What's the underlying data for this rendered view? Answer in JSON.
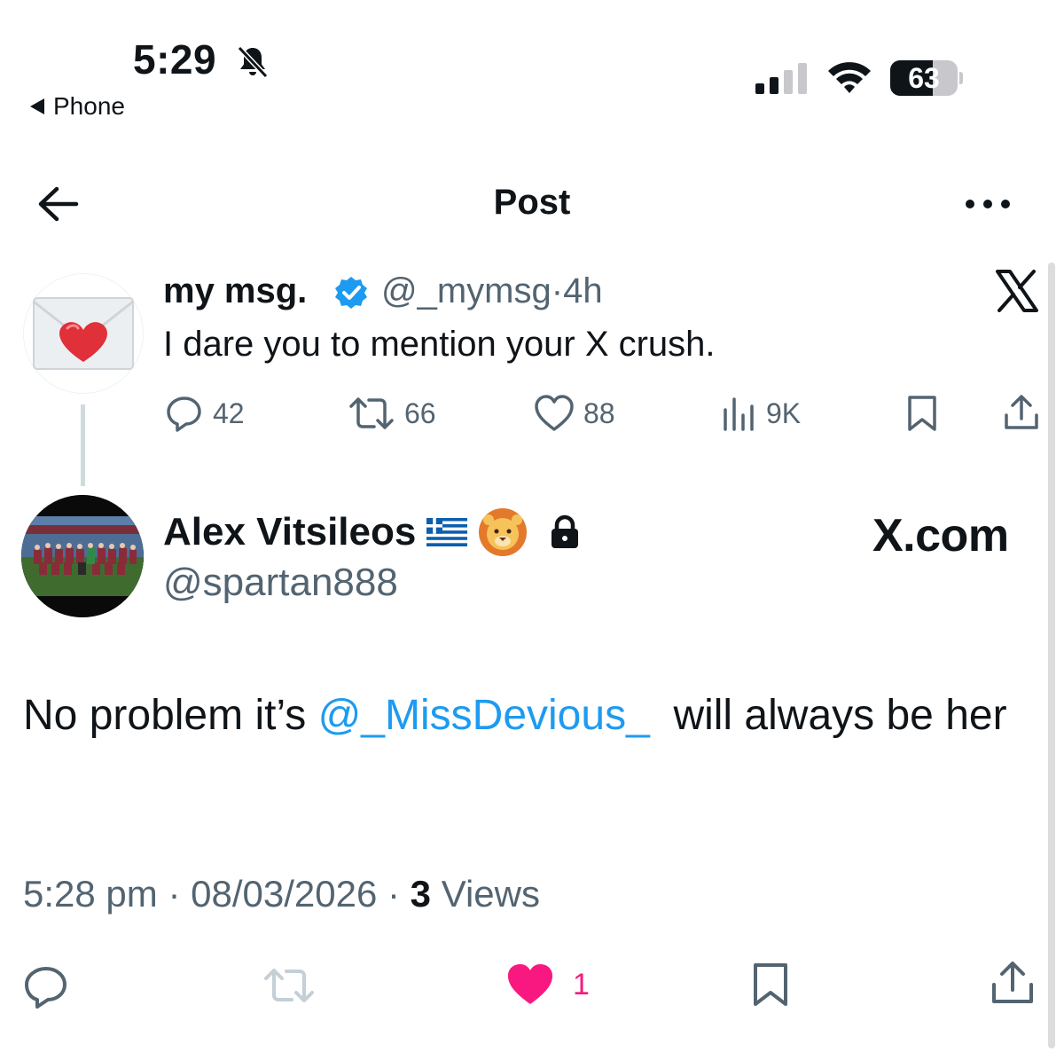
{
  "status_bar": {
    "time": "5:29",
    "back_app": "Phone",
    "battery": "63",
    "battery_level": 0.63
  },
  "header": {
    "title": "Post"
  },
  "parent_post": {
    "name": "my msg.",
    "handle": "@_mymsg",
    "separator": "·",
    "age": "4h",
    "text": "I dare you to mention your X crush.",
    "replies": "42",
    "reposts": "66",
    "likes": "88",
    "views": "9K"
  },
  "reply_post": {
    "name": "Alex Vitsileos",
    "handle": "@spartan888",
    "watermark": "X.com",
    "text_before": "No problem it’s ",
    "mention": "@_MissDevious_",
    "text_after": "  will always be her",
    "time": "5:28 pm",
    "date": "08/03/2026",
    "separator": "·",
    "views_count": "3",
    "views_label": "Views",
    "likes": "1"
  },
  "colors": {
    "accent_blue": "#1d9bf0",
    "like_pink": "#f91880",
    "muted_text": "#536471",
    "text": "#0f1419"
  }
}
